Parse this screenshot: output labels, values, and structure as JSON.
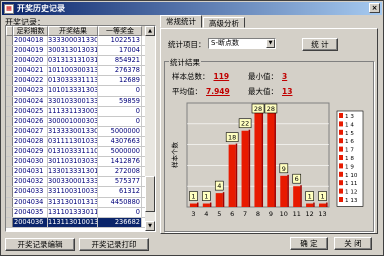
{
  "window": {
    "title": "开奖历史记录",
    "close_glyph": "×"
  },
  "records": {
    "label": "开奖记录：",
    "columns": [
      "足彩期数",
      "开奖结果",
      "一等奖金"
    ],
    "rows": [
      [
        "2004018",
        "3333000313303",
        "1022513"
      ],
      [
        "2004019",
        "3003130130313",
        "17004"
      ],
      [
        "2004020",
        "0313131310310",
        "854921"
      ],
      [
        "2004021",
        "1011003003130",
        "276378"
      ],
      [
        "2004022",
        "0130333311130",
        "12689"
      ],
      [
        "2004023",
        "1010133313033",
        "0"
      ],
      [
        "2004024",
        "3301033001331",
        "59859"
      ],
      [
        "2004025",
        "1113311330030",
        "0"
      ],
      [
        "2004026",
        "3000010003033",
        "0"
      ],
      [
        "2004027",
        "3133330013300",
        "5000000"
      ],
      [
        "2004028",
        "0311113010333",
        "4307663"
      ],
      [
        "2004029",
        "0131033311100",
        "5000000"
      ],
      [
        "2004030",
        "3011031030330",
        "1412876"
      ],
      [
        "2004031",
        "1330133313013",
        "272008"
      ],
      [
        "2004032",
        "3003300013333",
        "575377"
      ],
      [
        "2004033",
        "3311003100330",
        "61312"
      ],
      [
        "2004034",
        "3131301013130",
        "4450880"
      ],
      [
        "2004035",
        "1311013330111",
        "0"
      ],
      [
        "2004036",
        "1131130100133",
        "236682"
      ]
    ],
    "selected_row": 18
  },
  "buttons": {
    "edit": "开奖记录编辑",
    "print": "开奖记录打印",
    "ok": "确 定",
    "close": "关 闭",
    "stat": "统 计"
  },
  "tabs": [
    {
      "label": "常规统计",
      "active": true
    },
    {
      "label": "高级分析",
      "active": false
    }
  ],
  "stat_item": {
    "label": "统计项目：",
    "value": "S-断点数"
  },
  "results": {
    "title": "统计结果",
    "sample_label": "样本总数：",
    "sample_value": "119",
    "min_label": "最小值：",
    "min_value": "3",
    "avg_label": "平均值：",
    "avg_value": "7.949",
    "max_label": "最大值：",
    "max_value": "13"
  },
  "chart_data": {
    "type": "bar",
    "categories": [
      "3",
      "4",
      "5",
      "6",
      "7",
      "8",
      "9",
      "10",
      "11",
      "12",
      "13"
    ],
    "values": [
      1,
      1,
      4,
      18,
      22,
      28,
      28,
      9,
      6,
      1,
      1
    ],
    "ylabel": "样本个数",
    "ylim": [
      0,
      30
    ],
    "legend": [
      "1 3",
      "1 4",
      "1 5",
      "1 6",
      "1 7",
      "1 8",
      "1 9",
      "1 10",
      "1 11",
      "1 12",
      "1 13"
    ],
    "colors": {
      "bar": "#e81a00",
      "bar_dark": "#a00000",
      "label_bg": "#ffffc0",
      "plot_bg": "#d4d0c8",
      "grid": "#ffffff"
    }
  }
}
